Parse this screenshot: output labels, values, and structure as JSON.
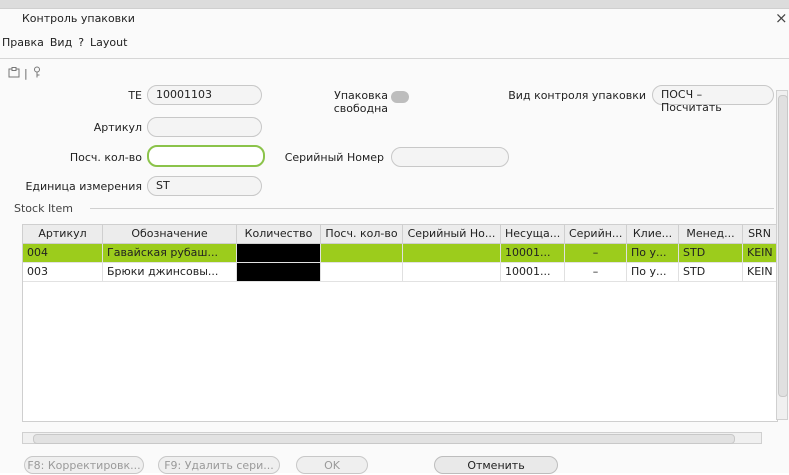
{
  "window": {
    "title": "Контроль упаковки",
    "close": "×"
  },
  "menu": [
    "Правка",
    "Вид",
    "?",
    "Layout"
  ],
  "toolbar": {
    "icons": [
      "clipboard-icon",
      "key-icon"
    ],
    "separator": "|"
  },
  "form": {
    "te_label": "TE",
    "te_value": "10001103",
    "pack_free_label": "Упаковка свободна",
    "control_type_label": "Вид контроля упаковки",
    "control_type_value": "ПОСЧ – Посчитать",
    "article_label": "Артикул",
    "article_value": "",
    "count_label": "Посч. кол-во",
    "count_value": "",
    "serial_label": "Серийный Номер",
    "serial_value": "",
    "unit_label": "Единица измерения",
    "unit_value": "ST"
  },
  "group_label": "Stock Item",
  "table": {
    "columns": [
      "Артикул",
      "Обозначение",
      "Количество",
      "Посч. кол-во",
      "Серийный Но...",
      "Несуща...",
      "Серийн...",
      "Клие...",
      "Менед...",
      "SRN"
    ],
    "rows": [
      [
        "004",
        "Гавайская рубаш...",
        "",
        "",
        "",
        "10001...",
        "–",
        "По у...",
        "STD",
        "KEIN"
      ],
      [
        "003",
        "Брюки джинсовы...",
        "",
        "",
        "",
        "10001...",
        "–",
        "По у...",
        "STD",
        "KEIN"
      ]
    ]
  },
  "buttons": {
    "correct": "F8: Корректировк...",
    "delete_serial": "F9: Удалить сери...",
    "ok": "OK",
    "cancel": "Отменить"
  }
}
